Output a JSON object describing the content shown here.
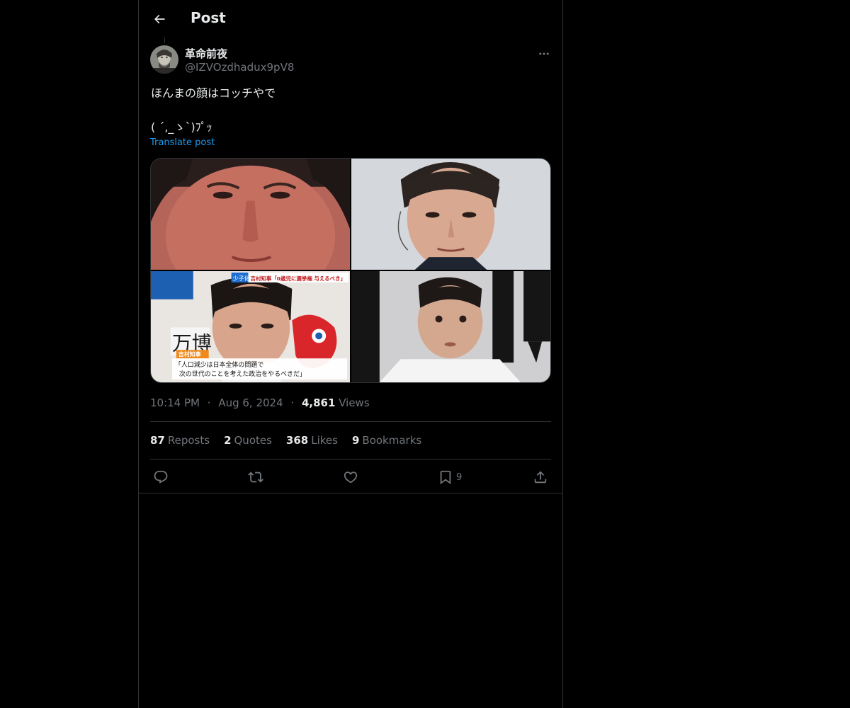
{
  "header": {
    "title": "Post"
  },
  "author": {
    "display_name": "革命前夜",
    "handle": "@IZVOzdhadux9pV8"
  },
  "post": {
    "line1": "ほんまの顔はコッチやで",
    "line2": "",
    "line3": "( ´,_ゝ`)ﾌﾟｯ",
    "translate_label": "Translate post"
  },
  "media": {
    "caption_top_tag": "少子化",
    "caption_top": "吉村知事「0歳児に選挙権 与えるべき」",
    "caption_badge": "吉村知事",
    "caption_line1": "「人口減少は日本全体の問題で",
    "caption_line2": "次の世代のことを考えた政治をやるべきだ」",
    "sign_text": "万博"
  },
  "meta": {
    "time": "10:14 PM",
    "date": "Aug 6, 2024",
    "views_count": "4,861",
    "views_label": "Views",
    "separator": "·"
  },
  "stats": {
    "reposts_count": "87",
    "reposts_label": "Reposts",
    "quotes_count": "2",
    "quotes_label": "Quotes",
    "likes_count": "368",
    "likes_label": "Likes",
    "bookmarks_count": "9",
    "bookmarks_label": "Bookmarks"
  },
  "actions": {
    "bookmark_count": "9"
  },
  "colors": {
    "background": "#000000",
    "text": "#e7e9ea",
    "muted": "#71767b",
    "link": "#1d9bf0",
    "border": "#2f3336"
  }
}
